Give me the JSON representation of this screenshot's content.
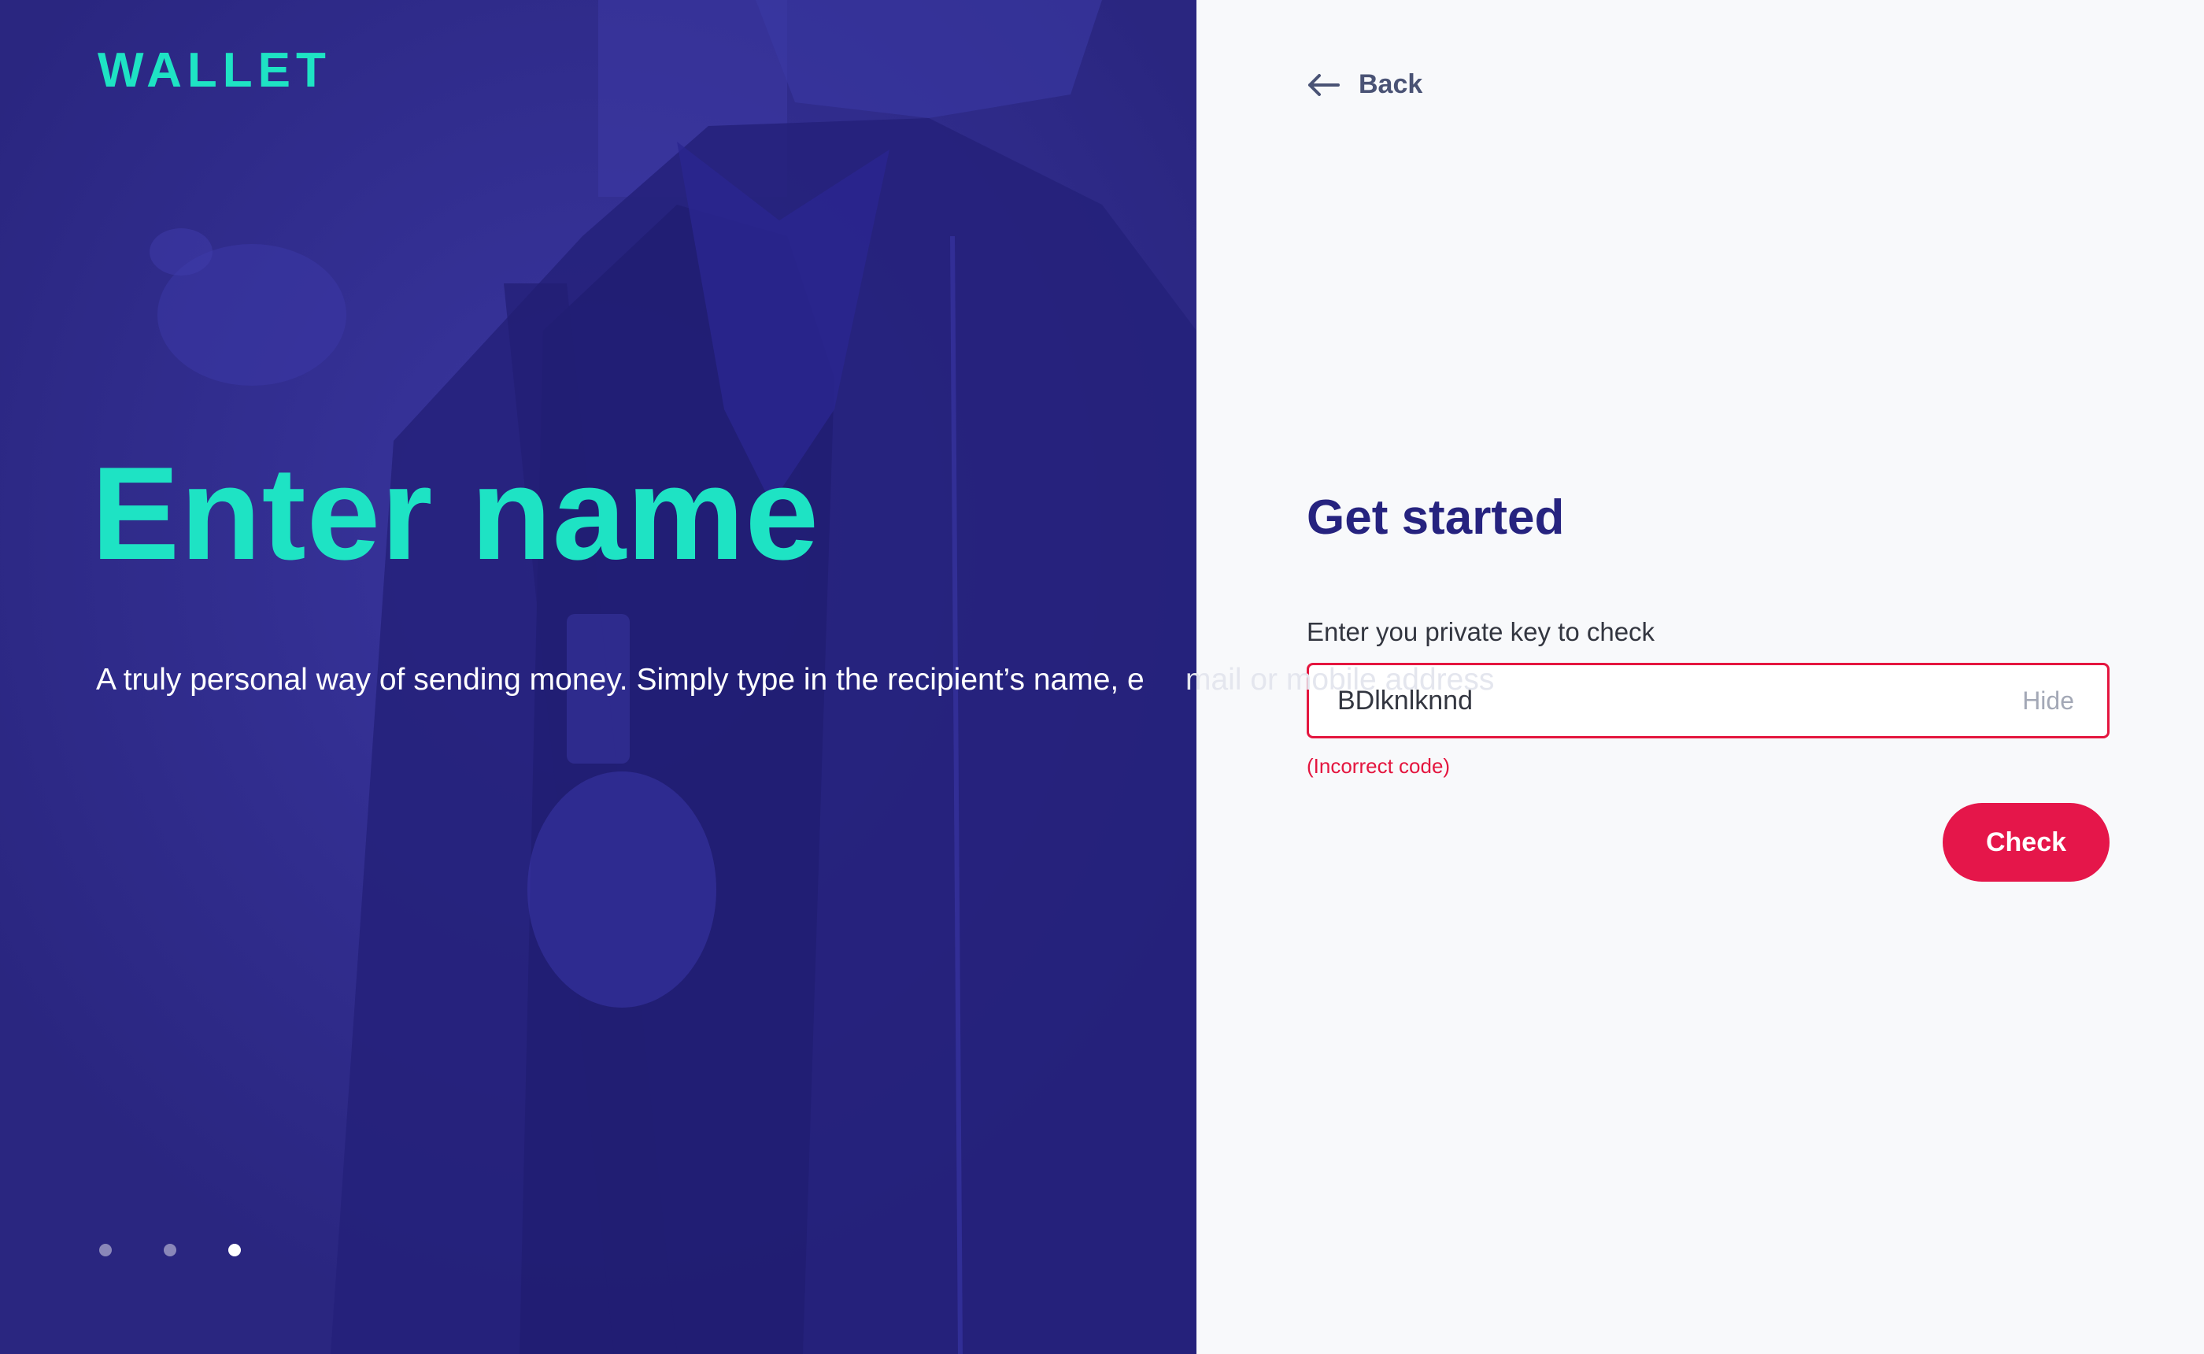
{
  "hero": {
    "logo": "WALLET",
    "headline": "Enter name",
    "subtitle": "A truly personal way of sending money. Simply type in the recipient’s name, e",
    "subtitle_overflow": "mail or mobile address",
    "carousel": {
      "count": 3,
      "active_index": 2
    }
  },
  "panel": {
    "back_label": "Back",
    "title": "Get started",
    "field_label": "Enter you private key to check",
    "key_value": "BDlknlknnd",
    "hide_label": "Hide",
    "error_text": "(Incorrect code)",
    "check_label": "Check"
  },
  "colors": {
    "accent_teal": "#1ee3c4",
    "hero_purple": "#2c2888",
    "title_navy": "#26237f",
    "error_red": "#e4163f"
  },
  "icons": {
    "back": "arrow-left-icon"
  }
}
